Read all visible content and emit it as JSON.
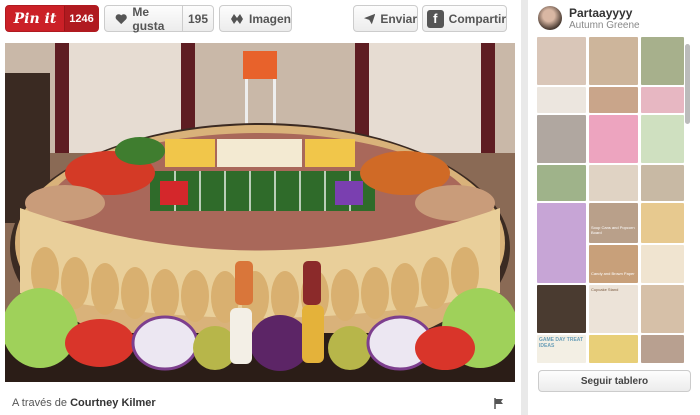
{
  "toolbar": {
    "pinit_label": "Pin it",
    "pinit_count": "1246",
    "like_label": "Me gusta",
    "like_count": "195",
    "image_label": "Imagen",
    "send_label": "Enviar",
    "share_label": "Compartir"
  },
  "attribution": {
    "prefix": "A través de",
    "author": "Courtney Kilmer"
  },
  "board": {
    "name": "Partaayyyy",
    "owner": "Autumn Greene",
    "follow_label": "Seguir tablero",
    "tiles": [
      {
        "label": ""
      },
      {
        "label": "Soup Cans and Popcorn Board"
      },
      {
        "label": "Candy and Brown Paper"
      },
      {
        "label": "Cupcake Stand"
      },
      {
        "label": "GAME DAY TREAT IDEAS"
      }
    ]
  },
  "colors": {
    "pin_red": "#cb2027",
    "field_green": "#2f6b2a"
  }
}
